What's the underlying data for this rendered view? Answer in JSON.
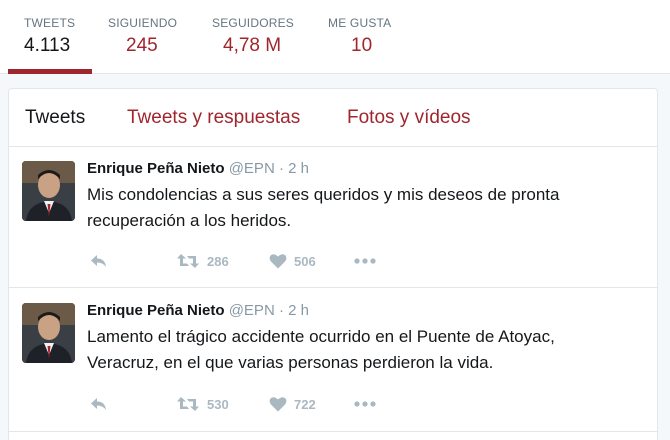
{
  "stats": [
    {
      "label": "TWEETS",
      "value": "4.113"
    },
    {
      "label": "SIGUIENDO",
      "value": "245"
    },
    {
      "label": "SEGUIDORES",
      "value": "4,78 M"
    },
    {
      "label": "ME GUSTA",
      "value": "10"
    }
  ],
  "tabs": [
    {
      "label": "Tweets"
    },
    {
      "label": "Tweets y respuestas"
    },
    {
      "label": "Fotos y vídeos"
    }
  ],
  "tweets": [
    {
      "name": "Enrique Peña Nieto",
      "handle": "@EPN",
      "time": "· 2 h",
      "text": "Mis condolencias a sus seres queridos y mis deseos de pronta recuperación a los heridos.",
      "retweets": "286",
      "likes": "506"
    },
    {
      "name": "Enrique Peña Nieto",
      "handle": "@EPN",
      "time": "· 2 h",
      "text": "Lamento el trágico accidente ocurrido en el Puente de Atoyac, Veracruz, en el que varias personas perdieron la vida.",
      "retweets": "530",
      "likes": "722"
    }
  ],
  "icons": {
    "reply": "reply-icon",
    "retweet": "retweet-icon",
    "like": "heart-icon",
    "more": "more-icon"
  },
  "colors": {
    "accent": "#a0262e",
    "muted": "#8899a6",
    "icon": "#aab8c2"
  }
}
